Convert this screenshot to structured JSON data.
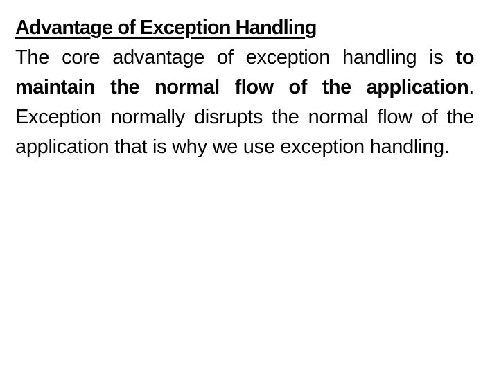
{
  "slide": {
    "title": "Advantage of Exception Handling",
    "paragraph": {
      "lead": "The core advantage of exception handling is ",
      "emphasis": "to maintain the normal flow of the application",
      "tail": ". Exception normally disrupts the normal flow of the application that is why we use exception handling."
    }
  }
}
